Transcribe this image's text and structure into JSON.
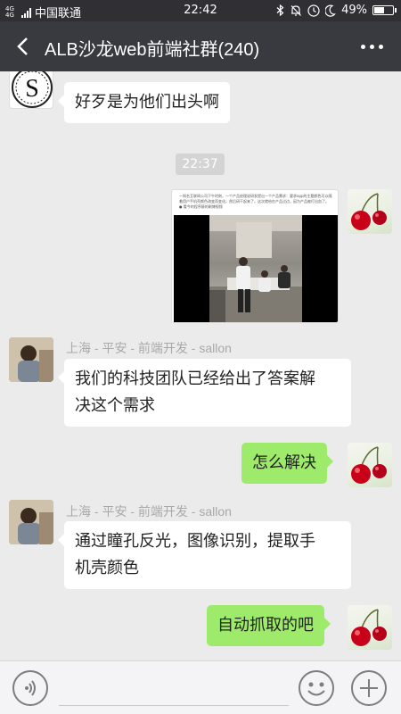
{
  "status_bar": {
    "network": "4G 4G",
    "carrier": "中国联通",
    "time": "22:42",
    "battery": "49%",
    "battery_level": 0.49,
    "icons": [
      "bluetooth-icon",
      "alarm-icon",
      "wifi-icon",
      "moon-icon",
      "battery-icon"
    ]
  },
  "header": {
    "title": "ALB沙龙web前端社群(240)",
    "back_icon": "back-chevron-icon",
    "more_icon": "more-dots-icon"
  },
  "chat": {
    "timestamp": "22:37",
    "messages": [
      {
        "side": "left",
        "avatar": "s-logo-avatar",
        "text": "好歹是为他们出头啊"
      },
      {
        "side": "right",
        "avatar": "cherry-avatar",
        "type": "image",
        "caption": "一知名互联网公司下午时刻，一个产品经理说研发提出一个产品需求：要求app的主题颜色可以随着用户手机壳颜色改变而变化。然后研干起来了。这次就给在产品过边，因为产品被打出血了。 ● 看今的程序猿的刷博视频"
      },
      {
        "side": "left",
        "avatar": "person-avatar",
        "sender": "上海 - 平安 - 前端开发 - sallon",
        "lines": [
          "我们的科技团队已经给出了答案解",
          "决这个需求"
        ]
      },
      {
        "side": "right",
        "avatar": "cherry-avatar",
        "text": "怎么解决"
      },
      {
        "side": "left",
        "avatar": "person-avatar",
        "sender": "上海 - 平安 - 前端开发 - sallon",
        "lines": [
          "通过瞳孔反光，图像识别，提取手",
          "机壳颜色"
        ]
      },
      {
        "side": "right",
        "avatar": "cherry-avatar",
        "text": "自动抓取的吧"
      }
    ]
  },
  "input_bar": {
    "voice_icon": "voice-icon",
    "emoji_icon": "emoji-icon",
    "plus_icon": "plus-icon"
  },
  "colors": {
    "title_bar": "#393a3f",
    "status_bar": "#2f2f34",
    "chat_bg": "#ebebeb",
    "green_bubble": "#9eea6a",
    "white_bubble": "#ffffff"
  }
}
